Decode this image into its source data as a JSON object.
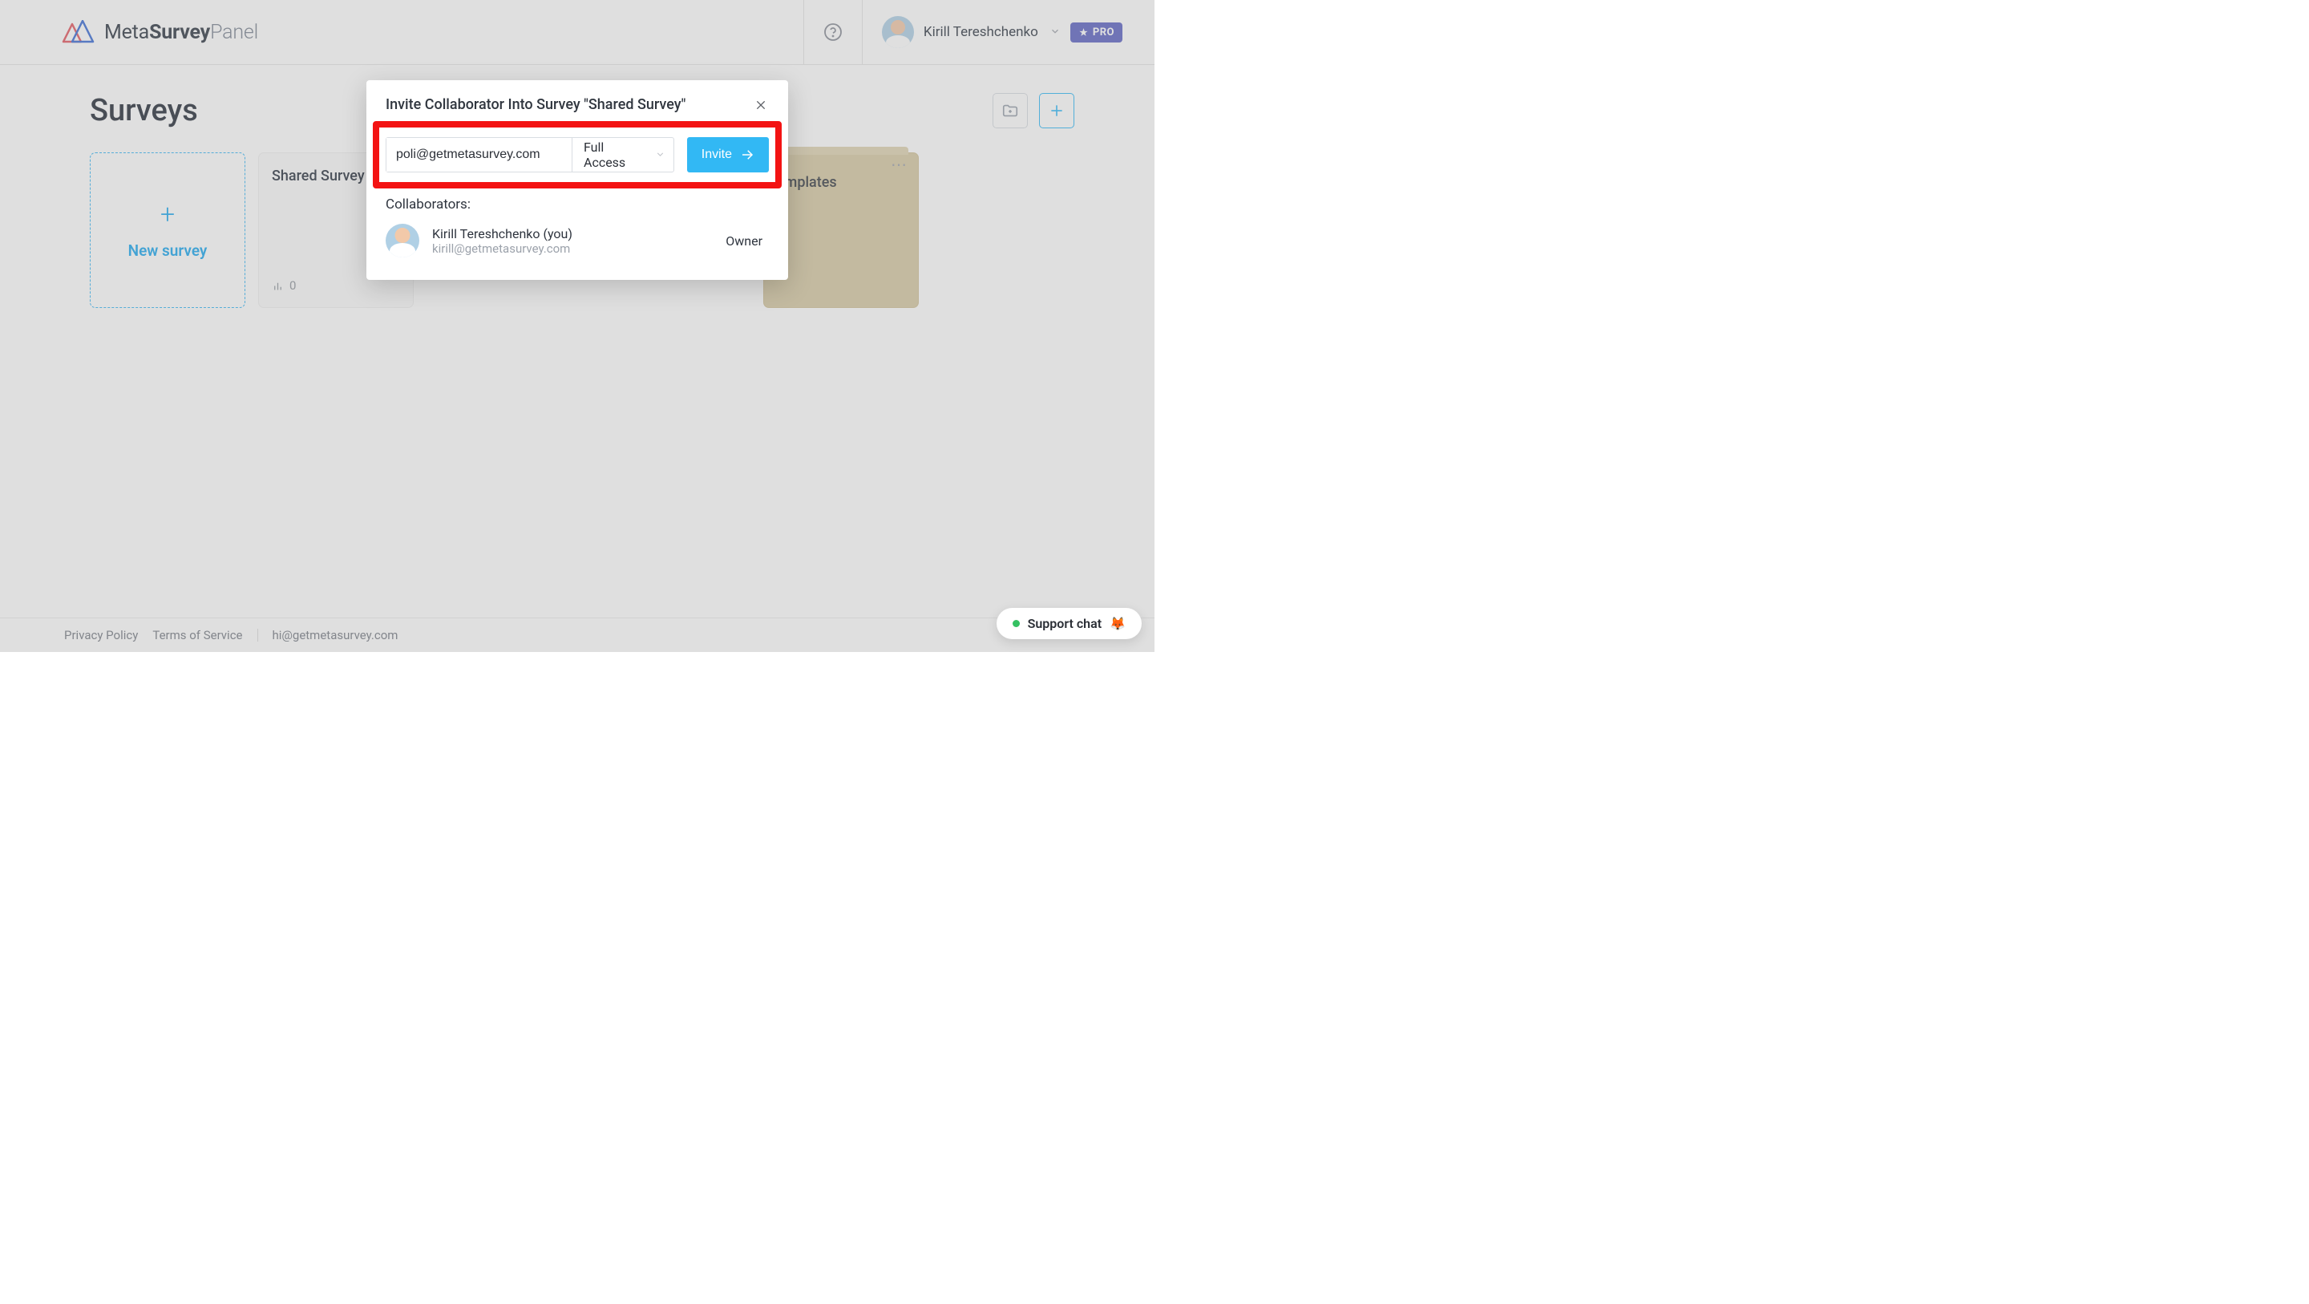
{
  "brand": {
    "meta": "Meta",
    "survey": "Survey",
    "panel": "Panel"
  },
  "header": {
    "user_name": "Kirill Tereshchenko",
    "pro_badge": "PRO"
  },
  "page": {
    "title": "Surveys"
  },
  "cards": {
    "new_label": "New survey",
    "shared": {
      "title": "Shared Survey",
      "stat": "0"
    },
    "templates": {
      "title": "emplates"
    }
  },
  "footer": {
    "privacy": "Privacy Policy",
    "terms": "Terms of Service",
    "email": "hi@getmetasurvey.com"
  },
  "support": {
    "label": "Support chat",
    "emoji": "🦊"
  },
  "modal": {
    "title": "Invite Collaborator Into Survey \"Shared Survey\"",
    "email_value": "poli@getmetasurvey.com",
    "access_label": "Full Access",
    "invite_label": "Invite",
    "collab_header": "Collaborators:",
    "collab": {
      "name": "Kirill Tereshchenko (you)",
      "email": "kirill@getmetasurvey.com",
      "role": "Owner"
    }
  }
}
